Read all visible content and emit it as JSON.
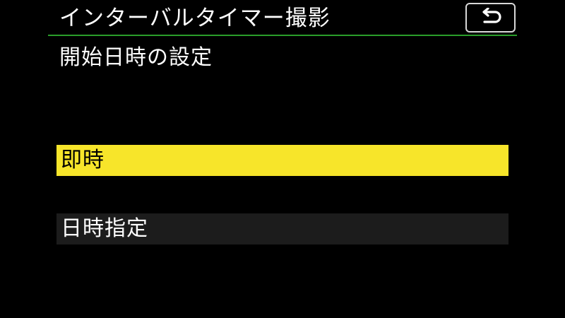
{
  "header": {
    "title": "インターバルタイマー撮影",
    "back_icon": "return-arrow-icon",
    "rule_color": "#2a9d2a"
  },
  "screen": {
    "subtitle": "開始日時の設定"
  },
  "options": [
    {
      "label": "即時",
      "selected": true
    },
    {
      "label": "日時指定",
      "selected": false
    }
  ],
  "colors": {
    "background": "#000000",
    "selected_bg": "#f7e52a",
    "selected_text": "#000000",
    "unselected_bg": "#1c1c1c",
    "text": "#ffffff"
  }
}
